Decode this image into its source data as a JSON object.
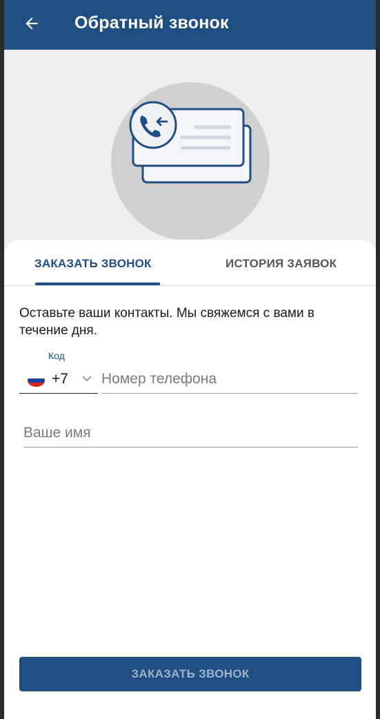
{
  "app": {
    "title": "Обратный звонок",
    "back_icon": "arrow-left-icon",
    "hero_icon": "callback-card-icon"
  },
  "tabs": [
    {
      "label": "ЗАКАЗАТЬ ЗВОНОК",
      "active": true
    },
    {
      "label": "ИСТОРИЯ ЗАЯВОК",
      "active": false
    }
  ],
  "form": {
    "intro": "Оставьте ваши контакты. Мы свяжемся с вами в течение дня.",
    "code_label": "Код",
    "country_code": "+7",
    "country_flag": "russia-flag-icon",
    "phone_placeholder": "Номер телефона",
    "name_placeholder": "Ваше имя",
    "submit_label": "ЗАКАЗАТЬ ЗВОНОК"
  },
  "colors": {
    "primary": "#1f4e82",
    "hero_bg": "#eeeeee",
    "hero_circle": "#d1d1d1",
    "disabled_text": "#9fb3ca"
  }
}
